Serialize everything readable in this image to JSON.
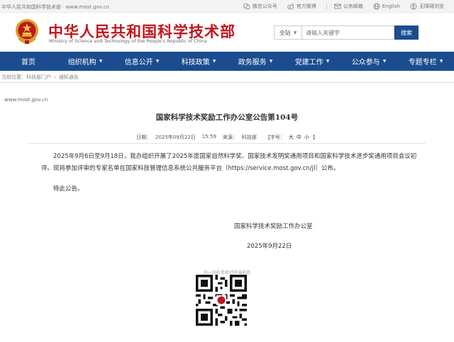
{
  "topbar": {
    "left_text": "中华人民共和国科学技术部 · www.most.gov.cn",
    "links": [
      {
        "label": "微信公众号",
        "icon": "wechat-icon"
      },
      {
        "label": "官方微博",
        "icon": "weibo-icon"
      },
      {
        "label": "公务邮箱",
        "icon": "mail-icon"
      },
      {
        "label": "English",
        "icon": "globe-icon"
      },
      {
        "label": "无障碍浏览",
        "icon": "accessibility-icon"
      }
    ]
  },
  "header": {
    "title": "中华人民共和国科学技术部",
    "subtitle": "Ministry of Science and Technology of the People's Republic of China",
    "emblem_icon": "national-emblem-icon"
  },
  "search": {
    "scope": "全站",
    "placeholder": "请输入关键字",
    "button": "搜索"
  },
  "nav": {
    "items": [
      {
        "label": "首页",
        "dropdown": false
      },
      {
        "label": "组织机构",
        "dropdown": true
      },
      {
        "label": "信息公开",
        "dropdown": true
      },
      {
        "label": "科技政策",
        "dropdown": true
      },
      {
        "label": "政务服务",
        "dropdown": true
      },
      {
        "label": "党建工作",
        "dropdown": true
      },
      {
        "label": "公众参与",
        "dropdown": true
      },
      {
        "label": "专题专栏",
        "dropdown": true
      }
    ]
  },
  "breadcrumb": {
    "prefix": "当前位置：",
    "items": [
      "科技部门户",
      "通知通告"
    ]
  },
  "watermark": "www.most.gov.cn",
  "article": {
    "title": "国家科学技术奖励工作办公室公告第104号",
    "date_label": "日期：",
    "date": "2025年09月22日",
    "time": "15:59",
    "source_label": "来源：",
    "source": "科技部",
    "font_size_label": "【字号：",
    "font_sizes": [
      "大",
      "中",
      "小"
    ],
    "font_size_end": "】",
    "paragraph1": "2025年9月6日至9月18日，我办组织开展了2025年度国家自然科学奖、国家技术发明奖通用项目和国家科学技术进步奖通用项目会议初评。现将参加评审的专家名单在国家科技管理信息系统公共服务平台（https://service.most.gov.cn/jl）公布。",
    "paragraph2": "特此公告。",
    "sign_org": "国家科学技术奖励工作办公室",
    "sign_date": "2025年9月22日"
  },
  "qr": {
    "caption": "扫一扫在手机打开当前页"
  },
  "colors": {
    "brand_red": "#c0161c",
    "nav_blue": "#1b4c8f"
  }
}
